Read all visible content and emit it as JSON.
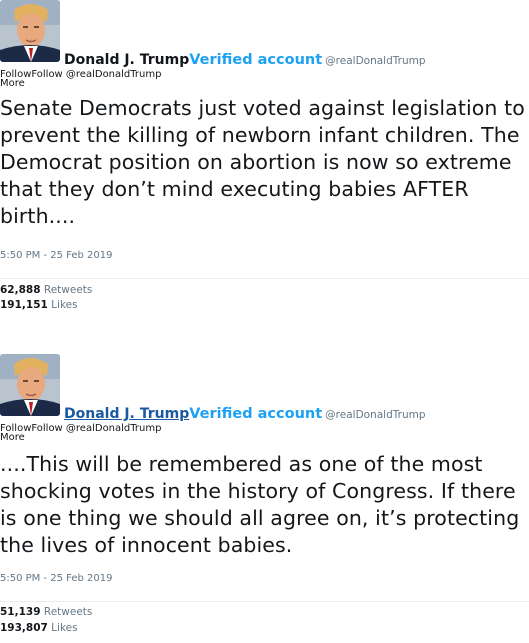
{
  "tweets": [
    {
      "display_name": "Donald J. Trump",
      "verified_label": "Verified account",
      "handle": "@realDonaldTrump",
      "follow_label": "FollowFollow @realDonaldTrump",
      "more_label": "More",
      "text": "Senate Democrats just voted against legislation to prevent the killing of newborn infant children. The Democrat position on abortion is now so extreme that they don’t mind executing babies AFTER birth....",
      "timestamp": "5:50 PM - 25 Feb 2019",
      "retweets_count": "62,888",
      "retweets_label": "Retweets",
      "likes_count": "191,151",
      "likes_label": "Likes"
    },
    {
      "display_name": "Donald J. Trump",
      "verified_label": "Verified account",
      "handle": "@realDonaldTrump",
      "follow_label": "FollowFollow @realDonaldTrump",
      "more_label": "More",
      "text": "....This will be remembered as one of the most shocking votes in the history of Congress. If there is one thing we should all agree on, it’s protecting the lives of innocent babies.",
      "timestamp": "5:50 PM - 25 Feb 2019",
      "retweets_count": "51,139",
      "retweets_label": "Retweets",
      "likes_count": "193,807",
      "likes_label": "Likes"
    }
  ],
  "colors": {
    "verified": "#1da1f2",
    "link": "#1b5aa0",
    "muted": "#657786",
    "text": "#14171a"
  }
}
